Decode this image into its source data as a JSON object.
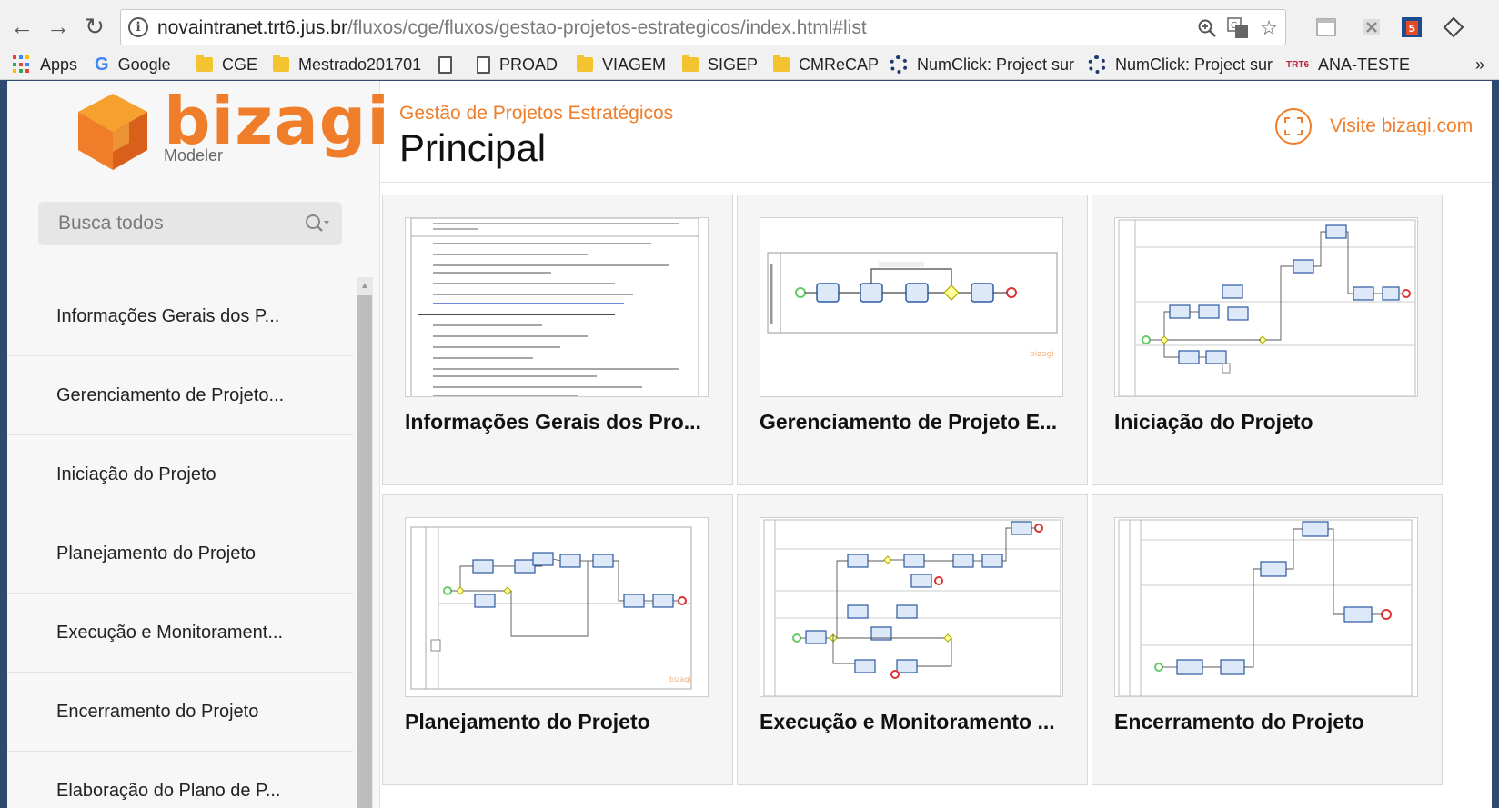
{
  "browser": {
    "url_host": "novaintranet.trt6.jus.br",
    "url_path": "/fluxos/cge/fluxos/gestao-projetos-estrategicos/index.html#list",
    "bookmarks": [
      "Apps",
      "Google",
      "CGE",
      "Mestrado201701",
      "",
      "PROAD",
      "VIAGEM",
      "SIGEP",
      "CMReCAP",
      "NumClick: Project sur",
      "NumClick: Project sur",
      "ANA-TESTE"
    ],
    "bookmarks_overflow": "»",
    "trt_label": "TRT6"
  },
  "logo": {
    "word": "bizagi",
    "sub": "Modeler"
  },
  "header": {
    "process_group": "Gestão de Projetos Estratégicos",
    "title": "Principal",
    "visit_link": "Visite bizagi.com"
  },
  "search": {
    "placeholder": "Busca todos"
  },
  "sidebar": {
    "items": [
      "Informações Gerais dos P...",
      "Gerenciamento de Projeto...",
      "Iniciação do Projeto",
      "Planejamento do Projeto",
      "Execução e Monitorament...",
      "Encerramento do Projeto",
      "Elaboração do Plano de P..."
    ]
  },
  "cards": [
    {
      "title": "Informações Gerais dos Pro...",
      "thumb": "document"
    },
    {
      "title": "Gerenciamento de Projeto E...",
      "thumb": "flow-simple"
    },
    {
      "title": "Iniciação do Projeto",
      "thumb": "flow-lanes"
    },
    {
      "title": "Planejamento do Projeto",
      "thumb": "flow-lanes"
    },
    {
      "title": "Execução e Monitoramento ...",
      "thumb": "flow-lanes"
    },
    {
      "title": "Encerramento do Projeto",
      "thumb": "flow-lanes"
    }
  ],
  "colors": {
    "brand": "#f07d2a",
    "card_bg": "#f5f5f5"
  }
}
